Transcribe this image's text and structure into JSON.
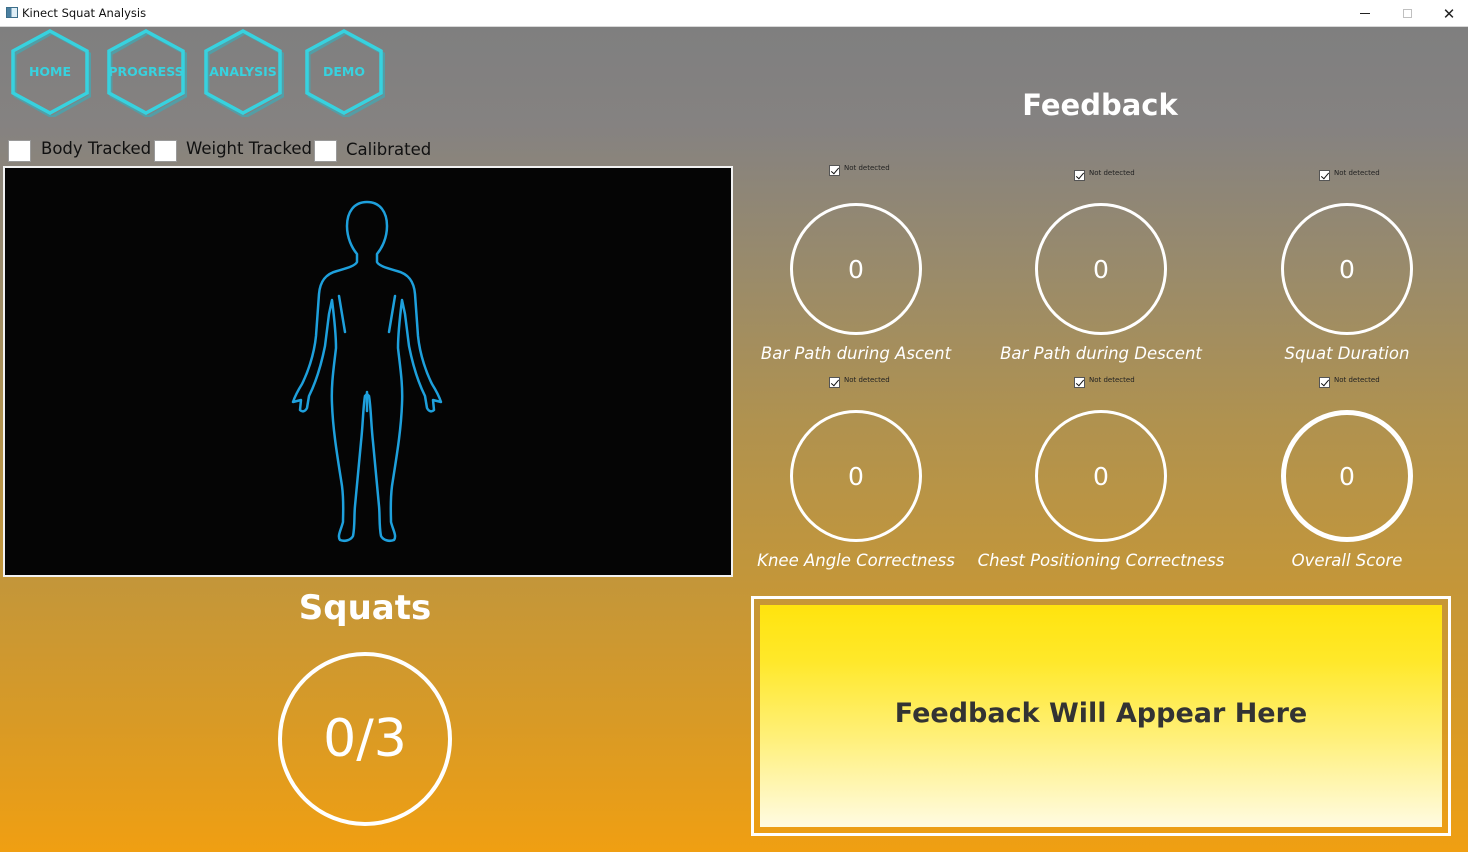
{
  "window": {
    "title": "Kinect Squat Analysis",
    "minimize_glyph": "—",
    "maximize_glyph": "☐",
    "close_glyph": "✕"
  },
  "nav": {
    "items": [
      {
        "label": "HOME",
        "icon": "hexagon"
      },
      {
        "label": "PROGRESS",
        "icon": "hexagon"
      },
      {
        "label": "ANALYSIS",
        "icon": "hexagon"
      },
      {
        "label": "DEMO",
        "icon": "hexagon"
      }
    ],
    "accent_color": "#37d2df"
  },
  "status": {
    "body_tracked": {
      "label": "Body Tracked",
      "checked": false
    },
    "weight_tracked": {
      "label": "Weight Tracked",
      "checked": false
    },
    "calibrated": {
      "label": "Calibrated",
      "checked": false
    }
  },
  "camera": {
    "figure_icon": "human-body-outline-icon",
    "figure_color": "#1ea0dc",
    "background": "#050505"
  },
  "squats": {
    "title": "Squats",
    "count": "0/3"
  },
  "feedback": {
    "title": "Feedback",
    "metrics": [
      {
        "label": "Bar Path during Ascent",
        "value": "0",
        "status": "Not detected",
        "checked": true
      },
      {
        "label": "Bar Path during Descent",
        "value": "0",
        "status": "Not detected",
        "checked": true
      },
      {
        "label": "Squat Duration",
        "value": "0",
        "status": "Not detected",
        "checked": true
      },
      {
        "label": "Knee Angle Correctness",
        "value": "0",
        "status": "Not detected",
        "checked": true
      },
      {
        "label": "Chest Positioning Correctness",
        "value": "0",
        "status": "Not detected",
        "checked": true
      },
      {
        "label": "Overall Score",
        "value": "0",
        "status": "Not detected",
        "checked": true
      }
    ],
    "message": "Feedback Will Appear Here"
  },
  "colors": {
    "gradient_top": "#7f7f7f",
    "gradient_bottom": "#f09f12",
    "feedback_panel_top": "#ffe40e",
    "feedback_panel_bottom": "#fffbe2"
  }
}
